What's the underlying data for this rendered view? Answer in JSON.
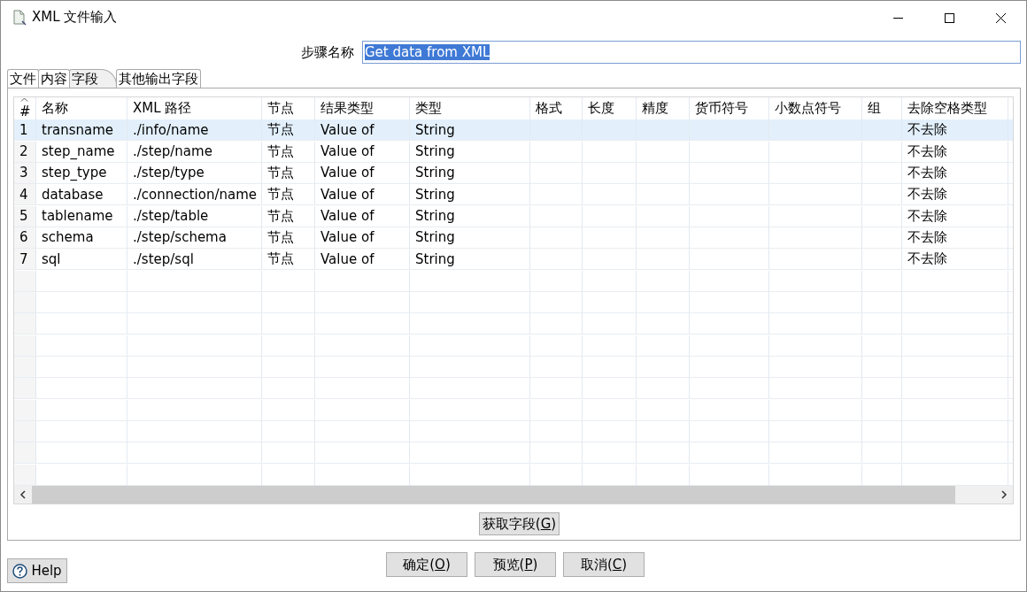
{
  "window": {
    "title": "XML 文件输入"
  },
  "step_name": {
    "label": "步骤名称",
    "value": "Get data from XML",
    "selected": true
  },
  "tabs": [
    {
      "label": "文件",
      "selected": false
    },
    {
      "label": "内容",
      "selected": false
    },
    {
      "label": "字段",
      "selected": true
    },
    {
      "label": "其他输出字段",
      "selected": false
    }
  ],
  "table": {
    "columns": [
      "#",
      "名称",
      "XML 路径",
      "节点",
      "结果类型",
      "类型",
      "格式",
      "长度",
      "精度",
      "货币符号",
      "小数点符号",
      "组",
      "去除空格类型"
    ],
    "rows": [
      {
        "number": "1",
        "name": "transname",
        "xml_path": "./info/name",
        "node": "节点",
        "result_type": "Value of",
        "type": "String",
        "trim_type": "不去除",
        "selected": true
      },
      {
        "number": "2",
        "name": "step_name",
        "xml_path": "./step/name",
        "node": "节点",
        "result_type": "Value of",
        "type": "String",
        "trim_type": "不去除",
        "selected": false
      },
      {
        "number": "3",
        "name": "step_type",
        "xml_path": "./step/type",
        "node": "节点",
        "result_type": "Value of",
        "type": "String",
        "trim_type": "不去除",
        "selected": false
      },
      {
        "number": "4",
        "name": "database",
        "xml_path": "./connection/name",
        "node": "节点",
        "result_type": "Value of",
        "type": "String",
        "trim_type": "不去除",
        "selected": false
      },
      {
        "number": "5",
        "name": "tablename",
        "xml_path": "./step/table",
        "node": "节点",
        "result_type": "Value of",
        "type": "String",
        "trim_type": "不去除",
        "selected": false
      },
      {
        "number": "6",
        "name": "schema",
        "xml_path": "./step/schema",
        "node": "节点",
        "result_type": "Value of",
        "type": "String",
        "trim_type": "不去除",
        "selected": false
      },
      {
        "number": "7",
        "name": "sql",
        "xml_path": "./step/sql",
        "node": "节点",
        "result_type": "Value of",
        "type": "String",
        "trim_type": "不去除",
        "selected": false
      }
    ]
  },
  "get_fields_button": {
    "prefix": "获取字段(",
    "key": "G",
    "suffix": ")"
  },
  "dialog_buttons": [
    {
      "prefix": "确定(",
      "key": "O",
      "suffix": ")"
    },
    {
      "prefix": "预览(",
      "key": "P",
      "suffix": ")"
    },
    {
      "prefix": "取消(",
      "key": "C",
      "suffix": ")"
    }
  ],
  "help_button": {
    "label": "Help"
  }
}
